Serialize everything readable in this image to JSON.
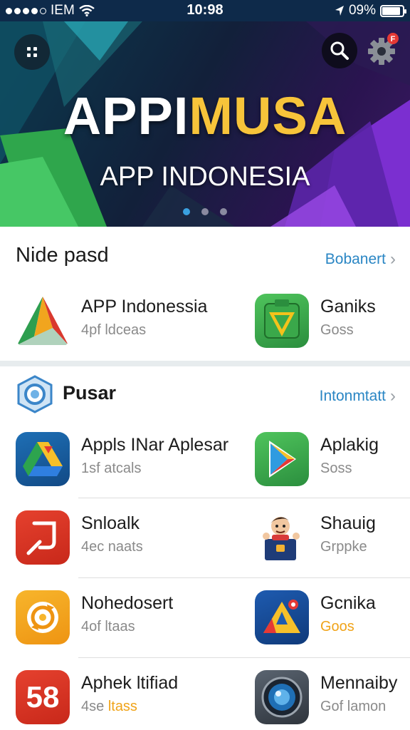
{
  "status_bar": {
    "carrier": "IEM",
    "time": "10:98",
    "battery": "09%",
    "battery_level": 0.9
  },
  "hero": {
    "brand_white": "APPI",
    "brand_yellow": "MUSA",
    "subtitle": "APP INDONESIA",
    "page_count": 3,
    "active_page": 1,
    "colors": {
      "accent_yellow": "#f7c43a",
      "green": "#3fbf5a",
      "purple": "#7b2fd0"
    }
  },
  "section1": {
    "title": "Nide pasd",
    "more": "Bobanert",
    "apps": [
      {
        "name": "APP Indonessia",
        "sub": "4pf ldceas",
        "icon": "triangle-logo-icon"
      },
      {
        "name": "Ganiks",
        "sub": "Goss",
        "icon": "green-check-icon"
      }
    ]
  },
  "section2": {
    "title": "Pusar",
    "more": "Intonmtatt",
    "icon": "blue-badge-icon",
    "rows": [
      [
        {
          "name": "Appls INar Aplesar",
          "sub": "1sf atcals",
          "icon": "drive-icon"
        },
        {
          "name": "Aplakig",
          "sub": "Soss",
          "icon": "play-store-icon"
        }
      ],
      [
        {
          "name": "Snloalk",
          "sub": "4ec naats",
          "icon": "red-bracket-icon"
        },
        {
          "name": "Shauig",
          "sub": "Grppke",
          "icon": "cartoon-character-icon"
        }
      ],
      [
        {
          "name": "Nohedosert",
          "sub": "4of ltaas",
          "icon": "orange-refresh-icon"
        },
        {
          "name": "Gcnika",
          "sub": "Goos",
          "sub_color": "orange",
          "icon": "triangle-badge-icon"
        }
      ],
      [
        {
          "name": "Aphek ltifiad",
          "sub_prefix": "4se ",
          "sub_highlight": "ltass",
          "icon": "number-58-icon",
          "icon_text": "58"
        },
        {
          "name": "Mennaiby",
          "sub": "Gof lamon",
          "icon": "camera-lens-icon"
        }
      ]
    ]
  }
}
